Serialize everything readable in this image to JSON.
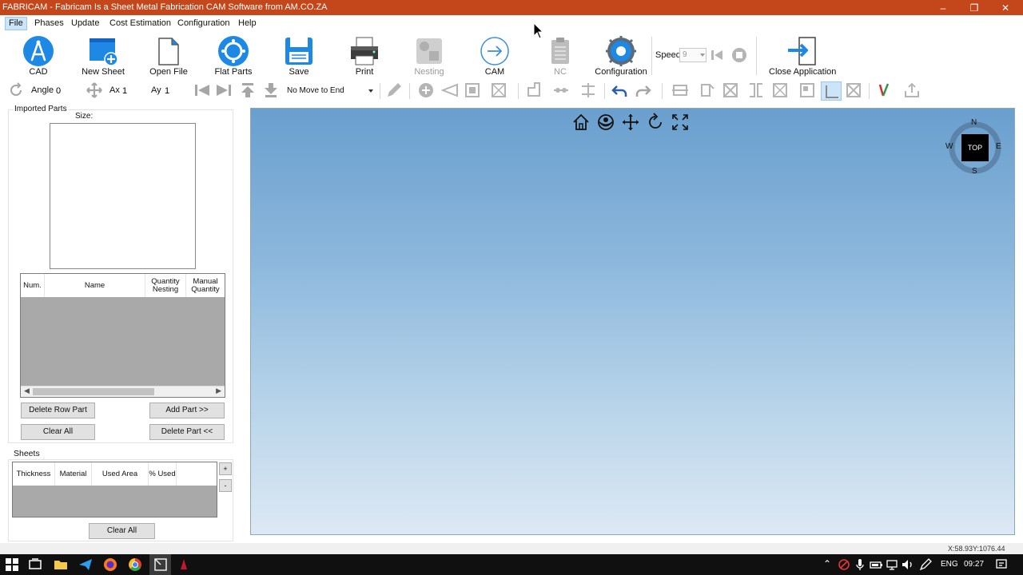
{
  "window": {
    "title": "FABRICAM - Fabricam Is a Sheet Metal Fabrication CAM Software from AM.CO.ZA",
    "minimize": "–",
    "maximize": "❐",
    "close": "✕"
  },
  "menu": [
    "File",
    "Phases",
    "Update",
    "Cost Estimation",
    "Configuration",
    "Help"
  ],
  "toolbar": {
    "cad": "CAD",
    "new_sheet": "New Sheet",
    "open_file": "Open File",
    "flat_parts": "Flat Parts",
    "save": "Save",
    "print": "Print",
    "nesting": "Nesting",
    "cam": "CAM",
    "nc": "NC",
    "configuration": "Configuration",
    "speed_label": "Speed",
    "speed_value": "9",
    "close_application": "Close Application"
  },
  "subtoolbar": {
    "angle_label": "Angle",
    "angle_value": "0",
    "ax_label": "Ax",
    "ax_value": "1",
    "ay_label": "Ay",
    "ay_value": "1",
    "move_mode": "No Move to End"
  },
  "left_panel": {
    "imported_parts_label": "Imported Parts",
    "size_label": "Size:",
    "parts_columns": [
      "Num.",
      "Name",
      "Quantity Nesting",
      "Manual Quantity"
    ],
    "delete_row_part": "Delete Row Part",
    "add_part": "Add Part >>",
    "clear_all": "Clear All",
    "delete_part": "Delete Part <<",
    "sheets_label": "Sheets",
    "sheets_columns": [
      "Thickness",
      "Material",
      "Used Area",
      "% Used"
    ],
    "plus": "+",
    "minus": "-",
    "sheets_clear_all": "Clear All"
  },
  "viewcube": {
    "n": "N",
    "s": "S",
    "e": "E",
    "w": "W",
    "face": "TOP"
  },
  "status": {
    "coords": "X:58.93Y:1076.44"
  },
  "taskbar": {
    "language": "ENG",
    "time": "09:27"
  },
  "colors": {
    "titlebar": "#c3471a",
    "accent_blue": "#1e88e5",
    "viewport_top": "#6a9fce",
    "viewport_bottom": "#dde9f4",
    "taskbar": "#101010"
  }
}
